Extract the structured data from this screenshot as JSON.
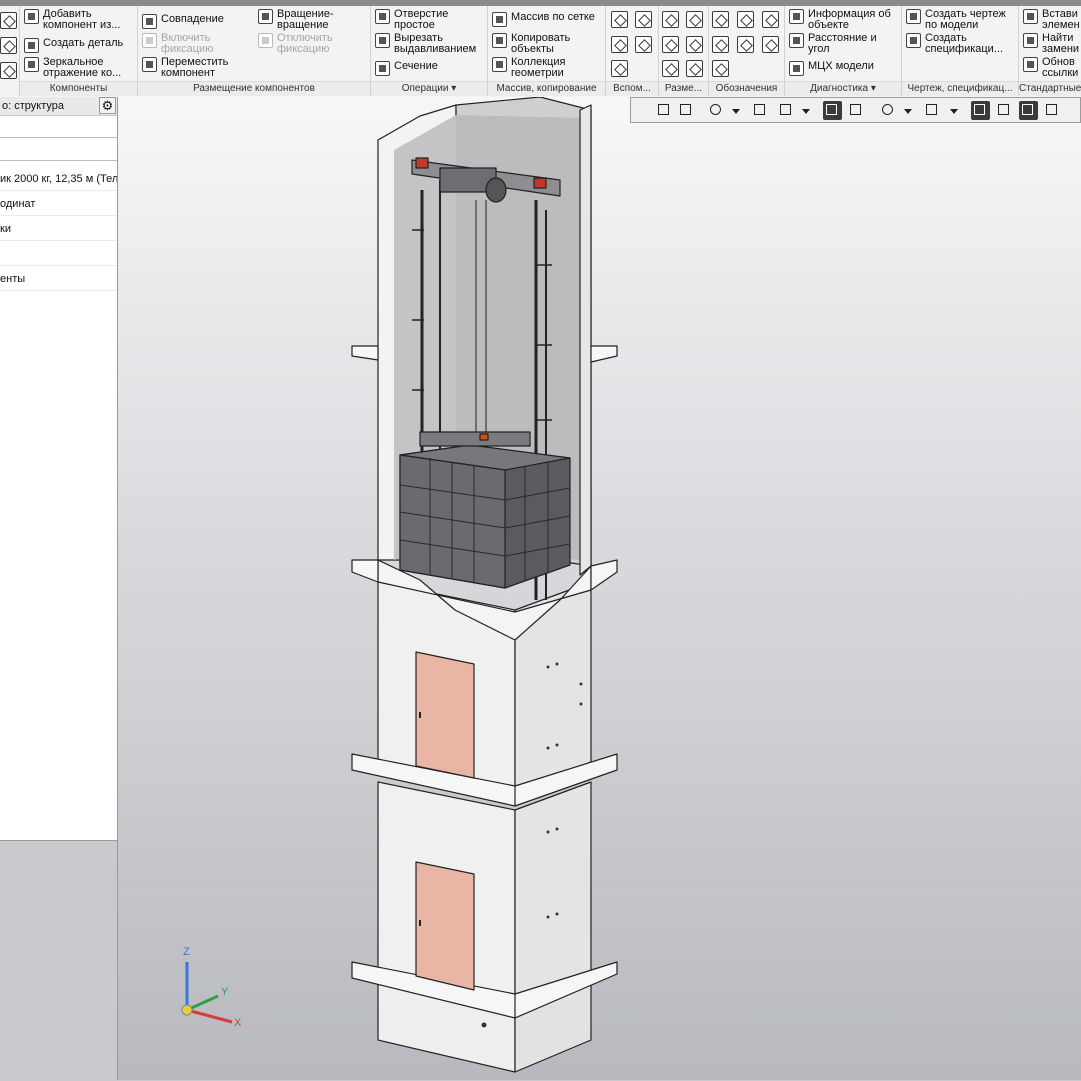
{
  "ribbon": {
    "components": {
      "label": "Компоненты",
      "add_component_l1": "Добавить",
      "add_component_l2": "компонент из...",
      "create_part": "Создать деталь",
      "mirror_l1": "Зеркальное",
      "mirror_l2": "отражение ко..."
    },
    "placement": {
      "label": "Размещение компонентов",
      "coincidence": "Совпадение",
      "rotation_l1": "Вращение-",
      "rotation_l2": "вращение",
      "enable_fix_l1": "Включить",
      "enable_fix_l2": "фиксацию",
      "disable_fix_l1": "Отключить",
      "disable_fix_l2": "фиксацию",
      "move_l1": "Переместить",
      "move_l2": "компонент"
    },
    "operations": {
      "label": "Операции",
      "hole_l1": "Отверстие",
      "hole_l2": "простое",
      "cut_l1": "Вырезать",
      "cut_l2": "выдавливанием",
      "section": "Сечение"
    },
    "array": {
      "label": "Массив, копирование",
      "grid_array": "Массив по сетке",
      "copy_l1": "Копировать",
      "copy_l2": "объекты",
      "collection_l1": "Коллекция",
      "collection_l2": "геометрии"
    },
    "aux": {
      "label": "Вспом..."
    },
    "dims": {
      "label": "Разме..."
    },
    "notations": {
      "label": "Обозначения"
    },
    "diagnostics": {
      "label": "Диагностика",
      "info_l1": "Информация об",
      "info_l2": "объекте",
      "distance_l1": "Расстояние и",
      "distance_l2": "угол",
      "mass": "МЦХ модели"
    },
    "drawing": {
      "label": "Чертеж, спецификац...",
      "create_drawing_l1": "Создать чертеж",
      "create_drawing_l2": "по модели",
      "create_spec_l1": "Создать",
      "create_spec_l2": "спецификаци..."
    },
    "standard": {
      "label": "Стандартные",
      "insert_l1": "Встави",
      "insert_l2": "элемен",
      "find_l1": "Найти",
      "find_l2": "замени",
      "update_l1": "Обнов",
      "update_l2": "ссылки"
    }
  },
  "panel": {
    "title": "о: структура",
    "items": [
      "ик 2000 кг, 12,35 м (Тел",
      "одинат",
      "ки",
      "",
      "енты"
    ]
  },
  "viewport": {
    "axes": {
      "z": "Z",
      "y": "Y",
      "x": "X"
    }
  },
  "colors": {
    "door": "#e9b6a6",
    "wall": "#f2f2f2",
    "background_top": "#f7f7f8",
    "background_bottom": "#b8b9be"
  }
}
